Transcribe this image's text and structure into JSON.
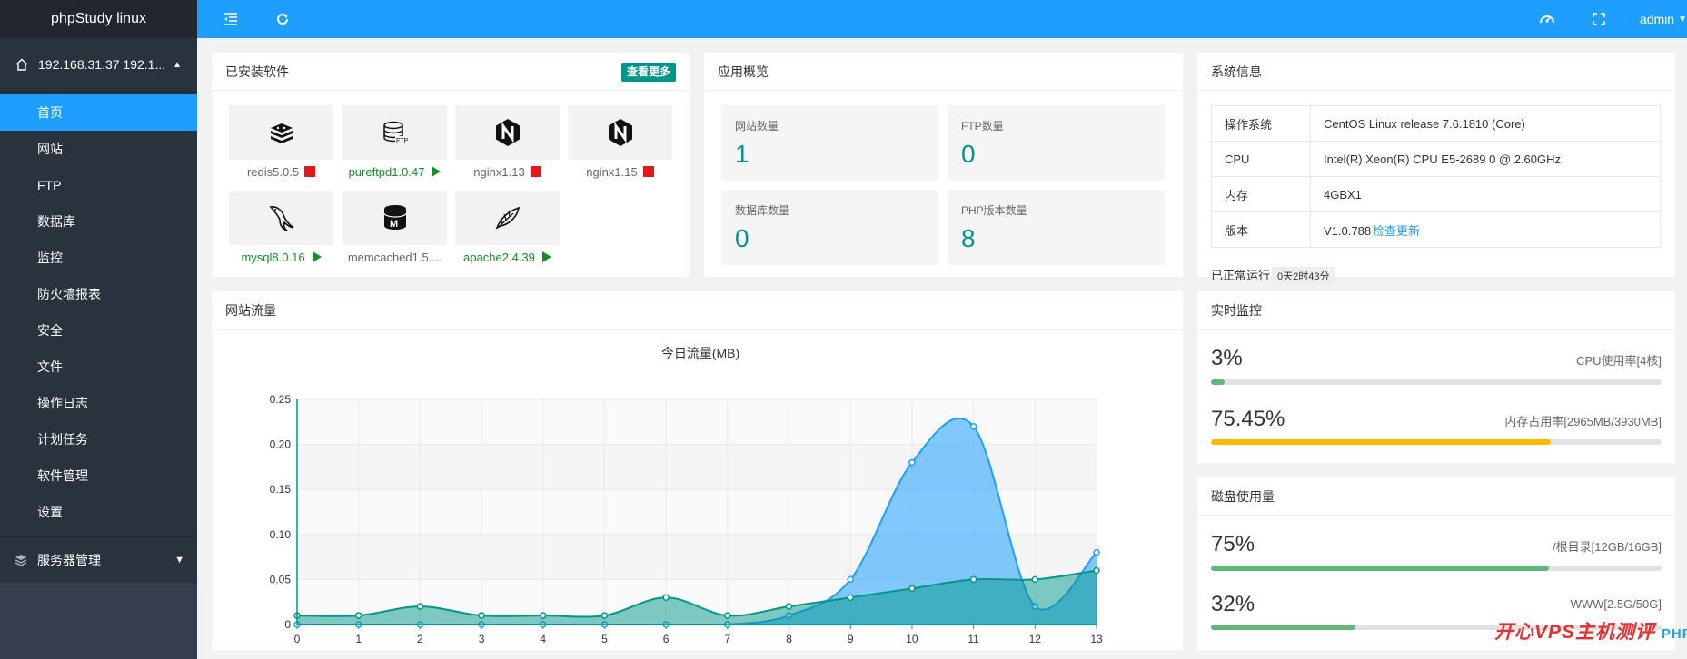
{
  "app": {
    "brand": "phpStudy linux",
    "server_name": "192.168.31.37 192.1...",
    "user": "admin"
  },
  "nav": {
    "items": [
      {
        "label": "首页",
        "active": true
      },
      {
        "label": "网站"
      },
      {
        "label": "FTP"
      },
      {
        "label": "数据库"
      },
      {
        "label": "监控"
      },
      {
        "label": "防火墙报表"
      },
      {
        "label": "安全"
      },
      {
        "label": "文件"
      },
      {
        "label": "操作日志"
      },
      {
        "label": "计划任务"
      },
      {
        "label": "软件管理"
      },
      {
        "label": "设置"
      }
    ],
    "group": "服务器管理"
  },
  "installed": {
    "title": "已安装软件",
    "more": "查看更多",
    "items": [
      {
        "name": "redis5.0.5",
        "status": "stopped",
        "icon": "redis-icon"
      },
      {
        "name": "pureftpd1.0.47",
        "status": "running",
        "icon": "ftp-database-icon"
      },
      {
        "name": "nginx1.13",
        "status": "stopped",
        "icon": "nginx-icon"
      },
      {
        "name": "nginx1.15",
        "status": "stopped",
        "icon": "nginx-icon"
      },
      {
        "name": "mysql8.0.16",
        "status": "running",
        "icon": "mysql-dolphin-icon"
      },
      {
        "name": "memcached1.5....",
        "status": "none",
        "icon": "memcached-icon"
      },
      {
        "name": "apache2.4.39",
        "status": "running",
        "icon": "apache-feather-icon"
      }
    ]
  },
  "overview": {
    "title": "应用概览",
    "stats": [
      {
        "label": "网站数量",
        "value": "1"
      },
      {
        "label": "FTP数量",
        "value": "0"
      },
      {
        "label": "数据库数量",
        "value": "0"
      },
      {
        "label": "PHP版本数量",
        "value": "8"
      }
    ]
  },
  "sysinfo": {
    "title": "系统信息",
    "rows": [
      {
        "key": "操作系统",
        "value": "CentOS Linux release 7.6.1810 (Core)",
        "link": ""
      },
      {
        "key": "CPU",
        "value": "Intel(R) Xeon(R) CPU E5-2689 0 @ 2.60GHz",
        "link": ""
      },
      {
        "key": "内存",
        "value": "4GBX1",
        "link": ""
      },
      {
        "key": "版本",
        "value": "V1.0.788",
        "link": "检查更新"
      }
    ],
    "uptime_label": "已正常运行",
    "uptime_value": "0天2时43分"
  },
  "traffic": {
    "title": "网站流量"
  },
  "monitor": {
    "title": "实时监控",
    "cpu": {
      "value": "3%",
      "label": "CPU使用率[4核]",
      "fraction": 0.03,
      "color": "#5fb878"
    },
    "mem": {
      "value": "75.45%",
      "label": "内存占用率[2965MB/3930MB]",
      "fraction": 0.7545,
      "color": "#ffb800"
    }
  },
  "disk": {
    "title": "磁盘使用量",
    "items": [
      {
        "value": "75%",
        "label": "/根目录[12GB/16GB]",
        "fraction": 0.75,
        "color": "#5fb878"
      },
      {
        "value": "32%",
        "label": "WWW[2.5G/50G]",
        "fraction": 0.32,
        "color": "#5fb878"
      }
    ]
  },
  "watermark": {
    "text": "开心VPS主机测评",
    "brand": "PHP中文网"
  },
  "chart_data": {
    "type": "area",
    "title": "今日流量(MB)",
    "x": [
      0,
      1,
      2,
      3,
      4,
      5,
      6,
      7,
      8,
      9,
      10,
      11,
      12,
      13
    ],
    "ylim": [
      0,
      0.25
    ],
    "yticks": [
      "0",
      "0.05",
      "0.10",
      "0.15",
      "0.20",
      "0.25"
    ],
    "series": [
      {
        "color": "#1e9fff",
        "values": [
          0,
          0,
          0,
          0,
          0,
          0,
          0,
          0,
          0.01,
          0.05,
          0.18,
          0.22,
          0.02,
          0.08
        ]
      },
      {
        "color": "#009688",
        "values": [
          0.01,
          0.01,
          0.02,
          0.01,
          0.01,
          0.01,
          0.03,
          0.01,
          0.02,
          0.03,
          0.04,
          0.05,
          0.05,
          0.06
        ]
      }
    ]
  }
}
